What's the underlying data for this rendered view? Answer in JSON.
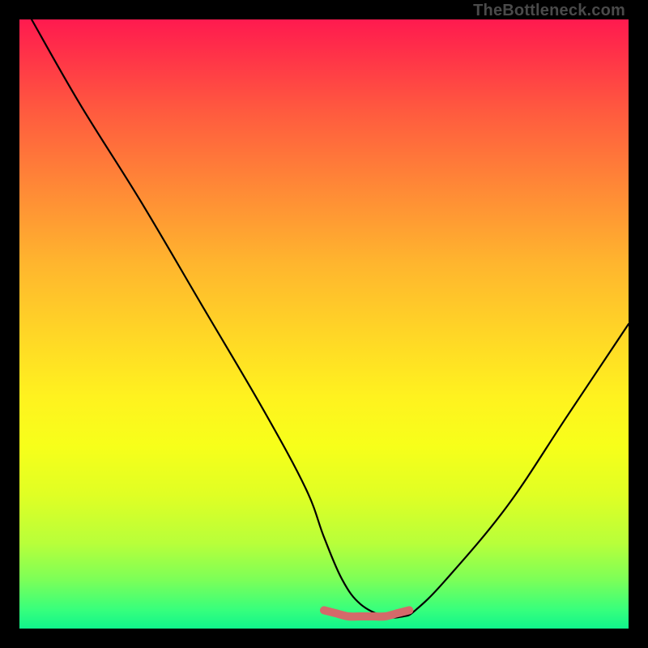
{
  "watermark": "TheBottleneck.com",
  "chart_data": {
    "type": "line",
    "title": "",
    "xlabel": "",
    "ylabel": "",
    "xlim": [
      0,
      100
    ],
    "ylim": [
      0,
      100
    ],
    "series": [
      {
        "name": "black-curve",
        "color": "#000000",
        "x": [
          2,
          10,
          20,
          30,
          40,
          47,
          50,
          53,
          56,
          60,
          63,
          65,
          70,
          80,
          90,
          100
        ],
        "y": [
          100,
          86,
          70,
          53,
          36,
          23,
          15,
          8,
          4,
          2,
          2,
          3,
          8,
          20,
          35,
          50
        ]
      },
      {
        "name": "flat-highlight",
        "color": "#d46a6a",
        "x": [
          50,
          52,
          54,
          56,
          58,
          60,
          62,
          64
        ],
        "y": [
          3,
          2.5,
          2,
          2,
          2,
          2,
          2.5,
          3
        ]
      }
    ],
    "annotations": []
  },
  "colors": {
    "gradient_top": "#ff1a4f",
    "gradient_bottom": "#10f48c",
    "curve": "#000000",
    "highlight": "#d46a6a",
    "frame": "#000000"
  }
}
